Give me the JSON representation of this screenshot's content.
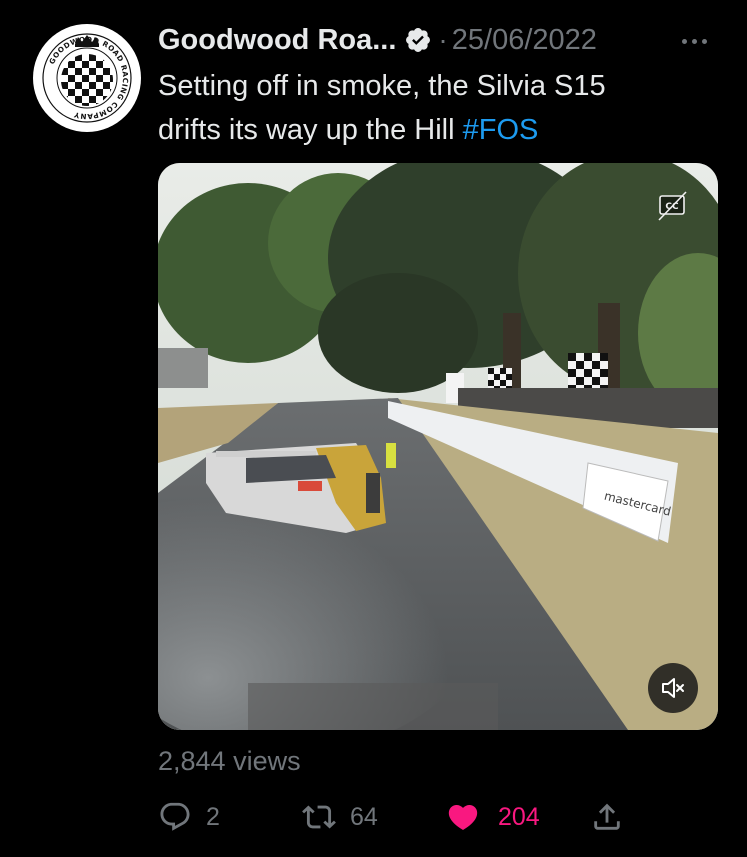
{
  "tweet": {
    "author_display": "Goodwood Roa...",
    "separator": "·",
    "date": "25/06/2022",
    "text_line1": "Setting off in smoke, the Silvia S15",
    "text_line2": "drifts its way up the Hill ",
    "hashtag": "#FOS",
    "views": "2,844 views",
    "avatar_ring_text": "GOODWOOD ROAD RACING COMPANY",
    "media": {
      "signage_text": "mastercard",
      "cc_label": "CC"
    }
  },
  "actions": {
    "reply_count": "2",
    "retweet_count": "64",
    "like_count": "204"
  },
  "icons": {
    "verified": "verified-badge-icon",
    "more": "more-horizontal-icon",
    "reply": "reply-icon",
    "retweet": "retweet-icon",
    "like": "heart-filled-icon",
    "share": "share-icon",
    "captions": "closed-captions-icon",
    "mute": "speaker-muted-icon"
  },
  "colors": {
    "background": "#000000",
    "text_primary": "#e7e9ea",
    "text_secondary": "#71767b",
    "link": "#1d9bf0",
    "like": "#f91880"
  }
}
